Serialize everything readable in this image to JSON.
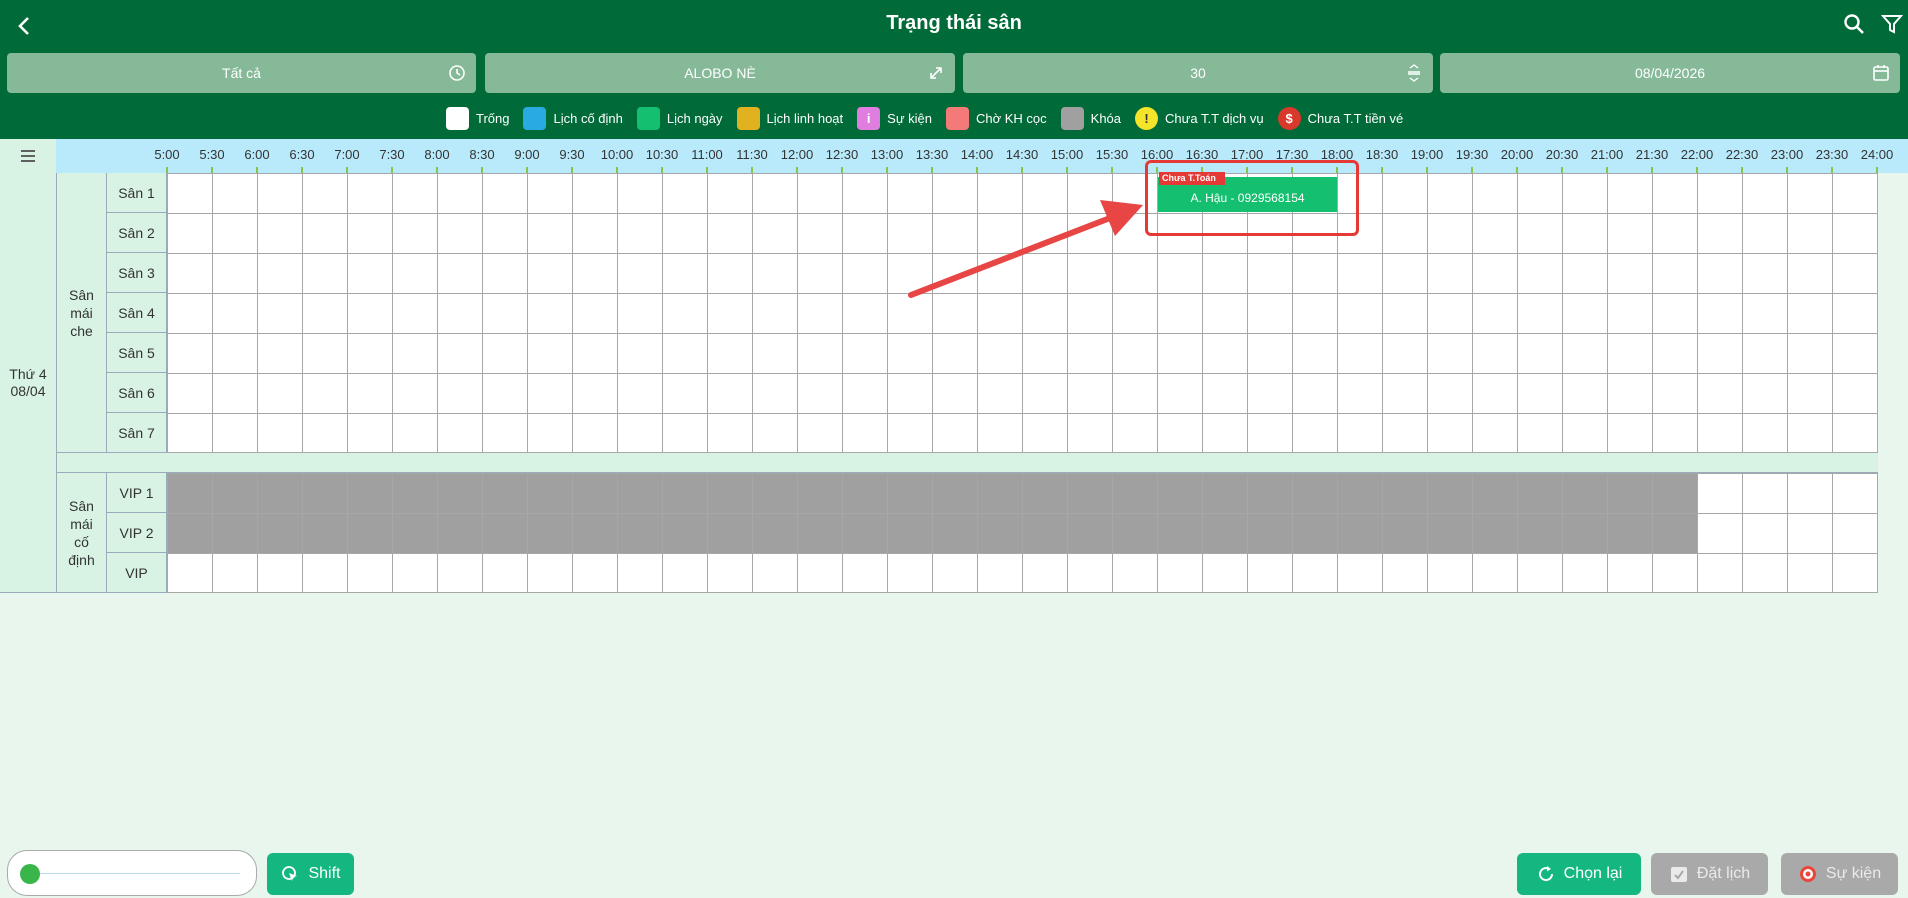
{
  "header": {
    "title": "Trạng thái sân",
    "filters": {
      "type": "Tất cả",
      "venue": "ALOBO NÈ",
      "interval": "30",
      "date": "08/04/2026"
    }
  },
  "legend": [
    {
      "label": "Trống",
      "color": "#ffffff",
      "symbol": ""
    },
    {
      "label": "Lịch cố định",
      "color": "#29abe2",
      "symbol": ""
    },
    {
      "label": "Lịch ngày",
      "color": "#14c070",
      "symbol": ""
    },
    {
      "label": "Lịch linh hoạt",
      "color": "#e0b21f",
      "symbol": ""
    },
    {
      "label": "Sự kiện",
      "color": "#e07ee0",
      "symbol": "i"
    },
    {
      "label": "Chờ KH cọc",
      "color": "#f47a7a",
      "symbol": ""
    },
    {
      "label": "Khóa",
      "color": "#a0a0a0",
      "symbol": ""
    },
    {
      "label": "Chưa T.T dịch vụ",
      "color": "#f5e52a",
      "symbol": "!"
    },
    {
      "label": "Chưa T.T tiền vé",
      "color": "#d9392b",
      "symbol": "$"
    }
  ],
  "timeline": {
    "times": [
      "5:00",
      "5:30",
      "6:00",
      "6:30",
      "7:00",
      "7:30",
      "8:00",
      "8:30",
      "9:00",
      "9:30",
      "10:00",
      "10:30",
      "11:00",
      "11:30",
      "12:00",
      "12:30",
      "13:00",
      "13:30",
      "14:00",
      "14:30",
      "15:00",
      "15:30",
      "16:00",
      "16:30",
      "17:00",
      "17:30",
      "18:00",
      "18:30",
      "19:00",
      "19:30",
      "20:00",
      "20:30",
      "21:00",
      "21:30",
      "22:00",
      "22:30",
      "23:00",
      "23:30",
      "24:00"
    ]
  },
  "schedule": {
    "day_line1": "Thứ 4",
    "day_line2": "08/04",
    "group1": {
      "name_lines": [
        "Sân",
        "mái",
        "che"
      ],
      "courts": [
        "Sân 1",
        "Sân 2",
        "Sân 3",
        "Sân 4",
        "Sân 5",
        "Sân 6",
        "Sân 7"
      ]
    },
    "group2": {
      "name_lines": [
        "Sân",
        "mái",
        "cố",
        "định"
      ],
      "courts": [
        "VIP 1",
        "VIP 2",
        "VIP"
      ],
      "locked_until": "22:00"
    }
  },
  "booking": {
    "court": "Sân 1",
    "start": "16:00",
    "end": "18:00",
    "customer": "A. Hậu - 0929568154",
    "tag": "Chưa T.Toán",
    "color": "#14c070"
  },
  "bottom": {
    "zoom_level": 0,
    "shift_label": "Shift",
    "reload_label": "Chọn lại",
    "book_label": "Đặt lịch",
    "event_label": "Sự kiện"
  }
}
